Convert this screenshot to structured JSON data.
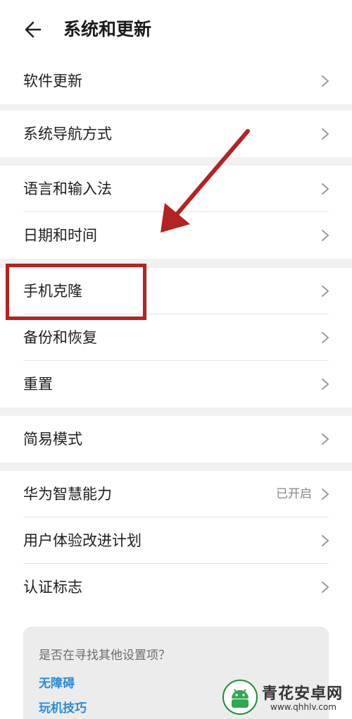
{
  "header": {
    "title": "系统和更新",
    "back_icon": "arrow-left-icon"
  },
  "groups": [
    {
      "items": [
        {
          "label": "软件更新"
        }
      ]
    },
    {
      "items": [
        {
          "label": "系统导航方式"
        }
      ]
    },
    {
      "items": [
        {
          "label": "语言和输入法"
        },
        {
          "label": "日期和时间"
        }
      ]
    },
    {
      "items": [
        {
          "label": "手机克隆"
        },
        {
          "label": "备份和恢复"
        },
        {
          "label": "重置"
        }
      ]
    },
    {
      "items": [
        {
          "label": "简易模式"
        }
      ]
    },
    {
      "items": [
        {
          "label": "华为智慧能力",
          "value": "已开启"
        },
        {
          "label": "用户体验改进计划"
        },
        {
          "label": "认证标志"
        }
      ]
    }
  ],
  "suggestions": {
    "title": "是否在寻找其他设置项？",
    "links": [
      "无障碍",
      "玩机技巧"
    ]
  },
  "annotation": {
    "color": "#b52222",
    "highlighted_item": "手机克隆"
  },
  "watermark": {
    "title": "青花安卓网",
    "url": "www.qhhlv.com"
  },
  "colors": {
    "background": "#f1f1f1",
    "card": "#ffffff",
    "link": "#2a8cd9",
    "chevron": "#9a9a9a"
  }
}
